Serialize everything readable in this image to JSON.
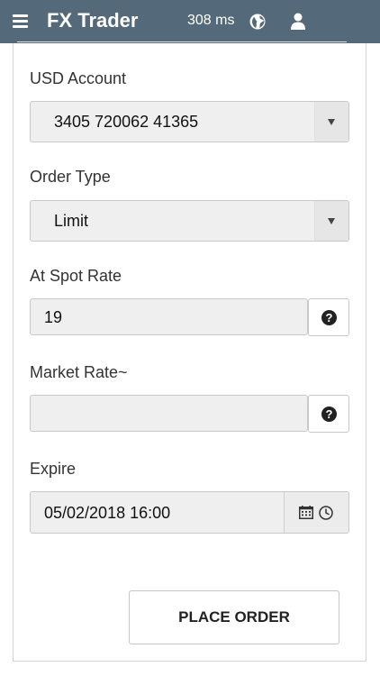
{
  "header": {
    "title": "FX Trader",
    "latency": "308 ms"
  },
  "form": {
    "account": {
      "label": "USD Account",
      "value": "3405 720062 41365"
    },
    "order_type": {
      "label": "Order Type",
      "value": "Limit"
    },
    "spot_rate": {
      "label": "At Spot Rate",
      "value": "19"
    },
    "market_rate": {
      "label": "Market Rate~",
      "value": ""
    },
    "expire": {
      "label": "Expire",
      "value": "05/02/2018 16:00"
    },
    "help_glyph": "?",
    "submit_label": "PLACE ORDER"
  },
  "colors": {
    "header_bg": "#546a7b",
    "field_bg": "#efefef"
  }
}
